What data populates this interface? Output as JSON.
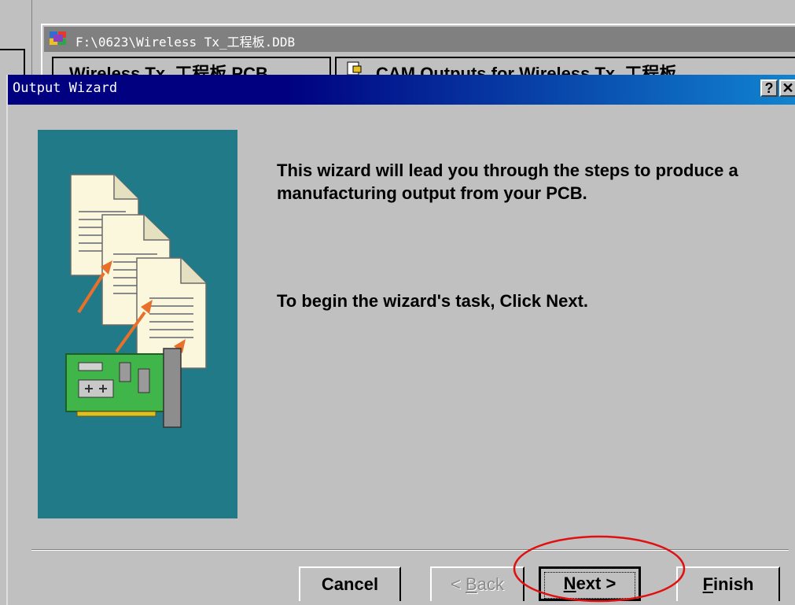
{
  "background_window": {
    "title": "F:\\0623\\Wireless Tx_工程板.DDB",
    "tabs": [
      "Wireless Tx_工程板.PCB",
      "CAM Outputs for Wireless Tx_工程板"
    ]
  },
  "dialog": {
    "title": "Output Wizard",
    "help_label": "?",
    "close_label": "✕",
    "message_primary": "This wizard will lead you through the steps to produce a manufacturing output from your PCB.",
    "message_secondary": "To begin the wizard's task, Click Next.",
    "buttons": {
      "cancel": "Cancel",
      "back_arrow": "< ",
      "back_accel": "B",
      "back_rest": "ack",
      "next_accel": "N",
      "next_rest": "ext >",
      "finish_accel": "F",
      "finish_rest": "inish"
    },
    "state": {
      "back_enabled": false,
      "focused_button": "next"
    }
  },
  "icons": [
    "app-icon",
    "document-icon",
    "document-icon",
    "document-icon",
    "orange-arrow-icon",
    "pcb-card-icon",
    "help-icon",
    "close-icon"
  ],
  "colors": {
    "titlebar_start": "#000080",
    "titlebar_end": "#1084d0",
    "wizard_panel": "#217a88",
    "dialog_face": "#c0c0c0",
    "annotation_circle": "#e01010",
    "pcb_green": "#3fb54a",
    "arrow_orange": "#e8702a"
  }
}
